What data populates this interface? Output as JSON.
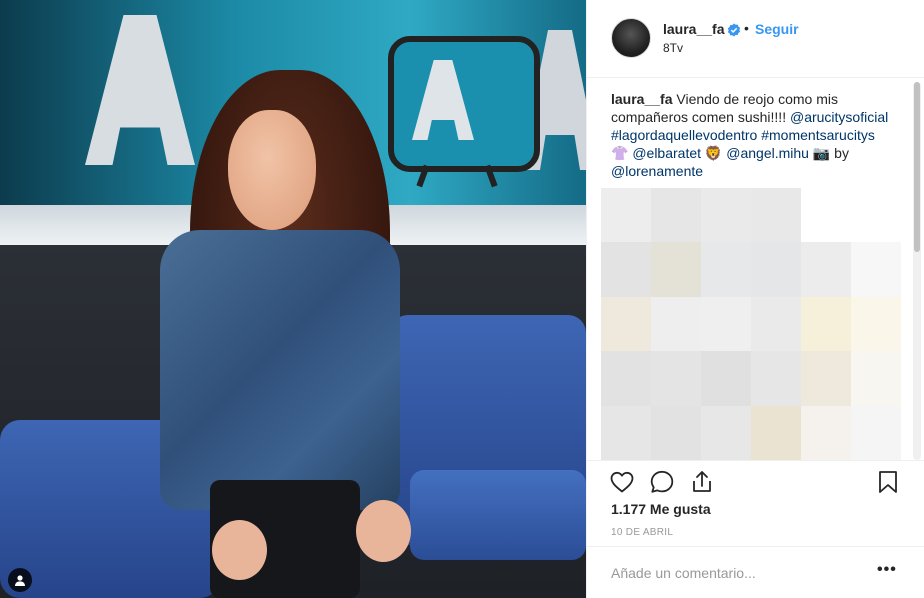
{
  "post": {
    "username": "laura__fa",
    "follow_label": "Seguir",
    "dot": "•",
    "location": "8Tv",
    "caption": {
      "username": "laura__fa",
      "text1": " Viendo de reojo como mis compañeros comen sushi!!!!",
      "tag1": "@arucitysoficial",
      "hash1": "#lagordaquellevodentro",
      "hash2": "#momentsarucitys",
      "emoji1": "👚",
      "tag2": "@elbaratet",
      "emoji2": "🦁",
      "tag3": "@angel.mihu",
      "emoji3": "📷",
      "by": " by ",
      "tag4": "@lorenamente"
    },
    "likes": "1.177 Me gusta",
    "date": "10 DE ABRIL",
    "comment_placeholder": "Añade un comentario...",
    "more_label": "•••"
  },
  "icons": {
    "verified": "verified-badge-icon",
    "like": "heart-icon",
    "comment": "comment-bubble-icon",
    "share": "share-icon",
    "save": "bookmark-icon",
    "user_tag": "user-tag-icon"
  },
  "colors": {
    "link": "#003569",
    "follow": "#3897f0",
    "verified": "#3897f0",
    "text": "#262626",
    "muted": "#999999"
  }
}
